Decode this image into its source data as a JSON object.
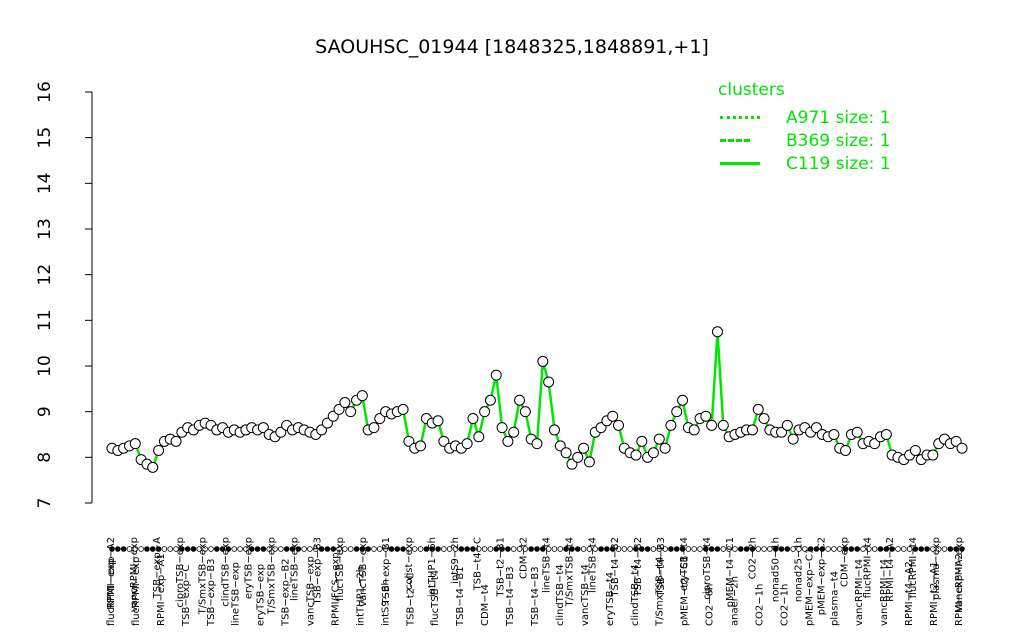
{
  "chart_data": {
    "type": "line",
    "title": "SAOUHSC_01944 [1848325,1848891,+1]",
    "xlabel": "",
    "ylabel": "",
    "ylim": [
      7,
      16
    ],
    "yticks": [
      7,
      8,
      9,
      10,
      11,
      12,
      13,
      14,
      15,
      16
    ],
    "legend": {
      "title": "clusters",
      "placement": "top-right",
      "entries": [
        {
          "label": "A971 size: 1",
          "style": "dotted"
        },
        {
          "label": "B369 size: 1",
          "style": "dashed"
        },
        {
          "label": "C119 size: 1",
          "style": "solid"
        }
      ]
    },
    "line_color": "#00e600",
    "series": [
      {
        "y": [
          8.2,
          8.15,
          8.2,
          8.25,
          8.3,
          7.95,
          7.85,
          7.78,
          8.15,
          8.35,
          8.4,
          8.35,
          8.55,
          8.65,
          8.6,
          8.7,
          8.75,
          8.7,
          8.6,
          8.65,
          8.55,
          8.6,
          8.55,
          8.6,
          8.65,
          8.6,
          8.65,
          8.5,
          8.45,
          8.55,
          8.7,
          8.6,
          8.65,
          8.6,
          8.55,
          8.5,
          8.6,
          8.75,
          8.9,
          9.05,
          9.2,
          9.0,
          9.25,
          9.35,
          8.6,
          8.65,
          8.85,
          9.0,
          8.95,
          9.0,
          9.05,
          8.35,
          8.2,
          8.25,
          8.85,
          8.75,
          8.8,
          8.35,
          8.2,
          8.25,
          8.2,
          8.3,
          8.85,
          8.45,
          9.0,
          9.25,
          9.8,
          8.65,
          8.35,
          8.55,
          9.25,
          9.0,
          8.4,
          8.3,
          10.1,
          9.65,
          8.6,
          8.25,
          8.1,
          7.85,
          8.0,
          8.2,
          7.9,
          8.55,
          8.65,
          8.8,
          8.9,
          8.7,
          8.2,
          8.1,
          8.05,
          8.35,
          8.0,
          8.1,
          8.4,
          8.2,
          8.7,
          9.0,
          9.25,
          8.65,
          8.6,
          8.85,
          8.9,
          8.7,
          10.75,
          8.7,
          8.45,
          8.5,
          8.55,
          8.6,
          8.6,
          9.05,
          8.85,
          8.6,
          8.55,
          8.55,
          8.7,
          8.4,
          8.6,
          8.65,
          8.55,
          8.65,
          8.5,
          8.45,
          8.5,
          8.2,
          8.15,
          8.5,
          8.55,
          8.3,
          8.35,
          8.3,
          8.45,
          8.5,
          8.05,
          8.0,
          7.95,
          8.05,
          8.15,
          7.95,
          8.05,
          8.05,
          8.3,
          8.4,
          8.3,
          8.35,
          8.2
        ]
      }
    ],
    "x_labels_top": [
      "RPMI−exp−A2",
      "vancRPMI−exp",
      "TSB−exp−A",
      "ciproTSB−exp",
      "T/SmxTSB−exp",
      "clindTSB−exp",
      "eryTSB−exp",
      "T/SmxTSB−exp",
      "lineTSB−exp",
      "TSB−exp−B3",
      "flucTSB−exp",
      "vancTSB−exp",
      "TSB−exp−B1",
      "colist−exp",
      "intTHP1−6h",
      "intS9−2h",
      "TSB−t4−C",
      "TSB−t2−B1",
      "CDM−t2",
      "lineTSB−t4",
      "T/SmxTSB−t4",
      "lineTSB−t4",
      "TSB−t4−B2",
      "TSB−t4−B2",
      "TSB−t4−B3",
      "eryTSB−t4",
      "ciproTSB−t4",
      "pMEM−t4−C1",
      "CO2−2h",
      "nonad50−1h",
      "nonad25−1h",
      "pMEM−exp−C2",
      "CDM−exp",
      "flucRPMI−t4",
      "RPMI−t4−A2",
      "flucRPMI−t4",
      "plasma−exp",
      "vancRPMI−exp"
    ],
    "x_labels_bottom": [
      "flucRPMI−exp",
      "flucRPMI−exp",
      "RPMI−exp−A1",
      "TSB−exp−C",
      "TSB−exp−B3",
      "lineTSB−exp",
      "eryTSB−exp",
      "TSB−exp−B2",
      "vancTSB−exp",
      "RPMI/FCS−exp",
      "intTHP1−2h",
      "intS9−6h",
      "TSB−t2−C",
      "flucTSB−t4",
      "TSB−t4−B1",
      "CDM−t4",
      "TSB−t4−B3",
      "TSB−t4−B3",
      "clindTSB−t4",
      "vancTSB−t4",
      "eryTSB−t4",
      "clindTSB−t4",
      "T/SmxTSB−t4",
      "pMEM−t2−C1",
      "CO2−6h",
      "anaer−2h",
      "CO2−1h",
      "CO2−1h",
      "pMEM−exp−C1",
      "plasma−t4",
      "vancRPMI−t4",
      "vancRPMI−t4",
      "RPMI−t4−A2",
      "RPMI−t2−A1",
      "RPMI−exp−A2"
    ]
  }
}
